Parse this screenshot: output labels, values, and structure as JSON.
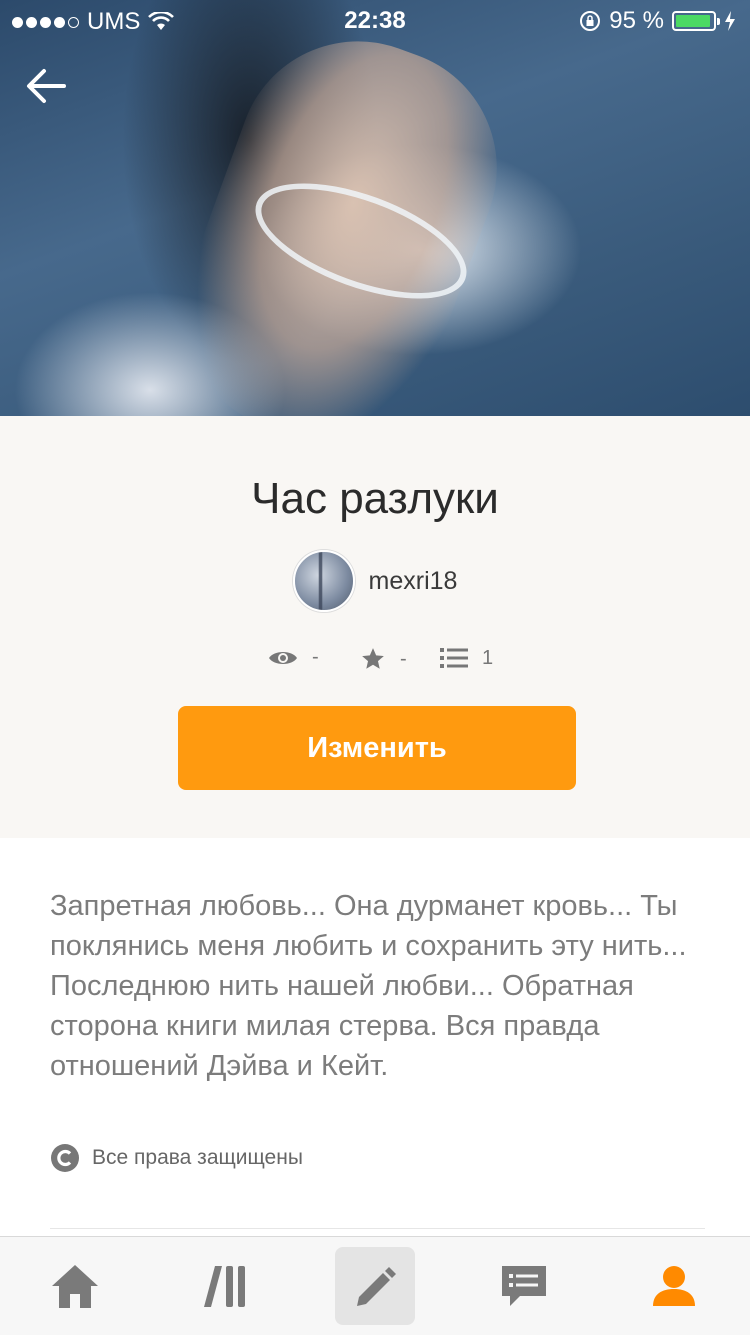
{
  "status_bar": {
    "carrier": "UMS",
    "time": "22:38",
    "battery": "95 %",
    "battery_level": 0.95
  },
  "story": {
    "title": "Час разлуки",
    "author": "mexri18",
    "views": "-",
    "votes": "-",
    "parts": "1",
    "edit_label": "Изменить",
    "description": "Запретная любовь... Она дурманет кровь... Ты поклянись меня любить и сохранить эту нить... Последнюю нить нашей любви... Обратная сторона книги милая стерва. Вся правда отношений Дэйва и Кейт.",
    "copyright": "Все права защищены"
  },
  "icons": {
    "back": "arrow-left-icon",
    "views": "eye-icon",
    "votes": "star-icon",
    "parts": "list-icon",
    "copyright": "copyright-icon",
    "tabs": [
      "home-icon",
      "library-icon",
      "pencil-icon",
      "chat-icon",
      "profile-icon"
    ]
  },
  "tab_bar": {
    "active_index": 2
  },
  "colors": {
    "accent": "#ff9a0f",
    "profile_tab": "#ff8a00",
    "tab_icon": "#7a7a7a",
    "battery": "#4cd964"
  }
}
